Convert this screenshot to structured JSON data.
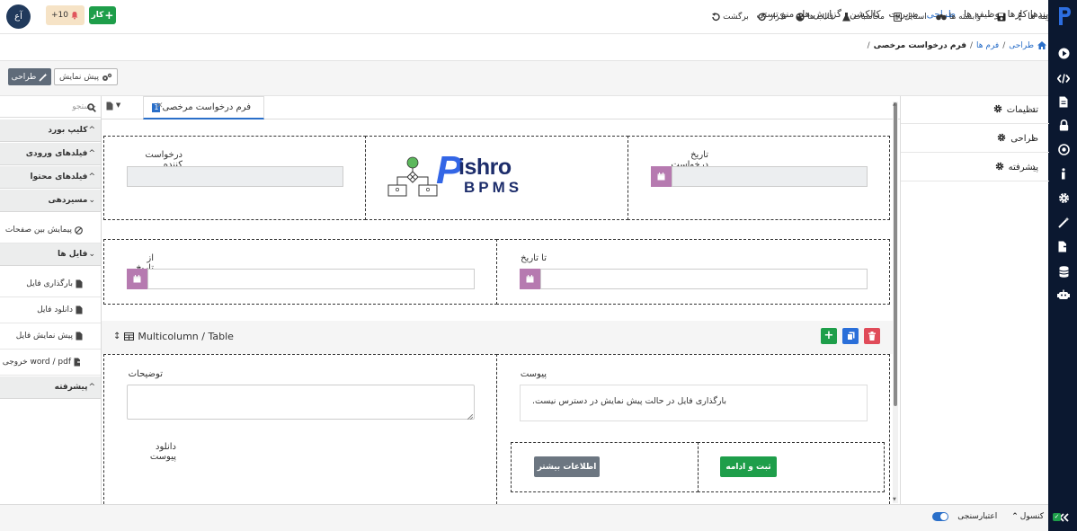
{
  "header": {
    "nav": [
      "فرایندها کارها",
      "وظیفه ها",
      "طراحی",
      "مدیریت",
      "کالکشن",
      "گزارش ها",
      "منو تستی"
    ],
    "active_nav": "طراحی",
    "avatar_initials": "آع",
    "notif_count": "+10",
    "add_task_label": "کار"
  },
  "breadcrumb": {
    "items": [
      "طراحی",
      "فرم ها",
      "فرم درخواست مرخصی"
    ],
    "separator": "/"
  },
  "toolbar": {
    "options": "گزینه ها",
    "items": [
      "وابسته ها",
      "استایل",
      "محاسبات",
      "قالب ها",
      "تکرار",
      "برگشت"
    ],
    "design_label": "طراحی",
    "preview_label": "پیش نمایش"
  },
  "settings_panel": {
    "items": [
      "تنظیمات",
      "طراحی",
      "پیشرفته"
    ]
  },
  "palette": {
    "search_placeholder": "جستجو",
    "groups": {
      "clipboard": "کلیپ بورد",
      "input_fields": "فیلدهای ورودی",
      "content_fields": "فیلدهای محتوا",
      "routing": "مسیردهی",
      "files": "فایل ها",
      "advanced": "پیشرفته"
    },
    "items": {
      "page_nav": "پیمایش بین صفحات",
      "file_upload": "بارگذاری فایل",
      "file_download": "دانلود فایل",
      "file_preview": "پیش نمایش فایل",
      "export": "خروجی word / pdf"
    }
  },
  "tab": {
    "number": "1",
    "label": "فرم درخواست مرخصی"
  },
  "form": {
    "requester_label": "درخواست کننده",
    "request_date_label": "تاریخ درخواست",
    "logo_text_top": "ishro",
    "logo_text_bottom": "BPMS",
    "logo_letter": "P",
    "from_date_label": "از تاریخ",
    "to_date_label": "تا تاریخ",
    "multicolumn_label": "Multicolumn / Table",
    "description_label": "توضیحات",
    "attachment_label": "پیوست",
    "attachment_notice": "بارگذاری فایل در حالت پیش نمایش در دسترس نیست.",
    "download_attachment_label": "دانلود پیوست",
    "submit_label": "ثبت و ادامه",
    "more_info_label": "اطلاعات بیشتر"
  },
  "footer": {
    "console_label": "کنسول",
    "validation_label": "اعتبارسنجی"
  },
  "colors": {
    "primary": "#2a6fc9",
    "success": "#1e9e4a",
    "danger": "#e04b59",
    "calendar": "#b67ab0",
    "sidebar_dark": "#0b1830",
    "logo_navy": "#1d2d6b"
  }
}
